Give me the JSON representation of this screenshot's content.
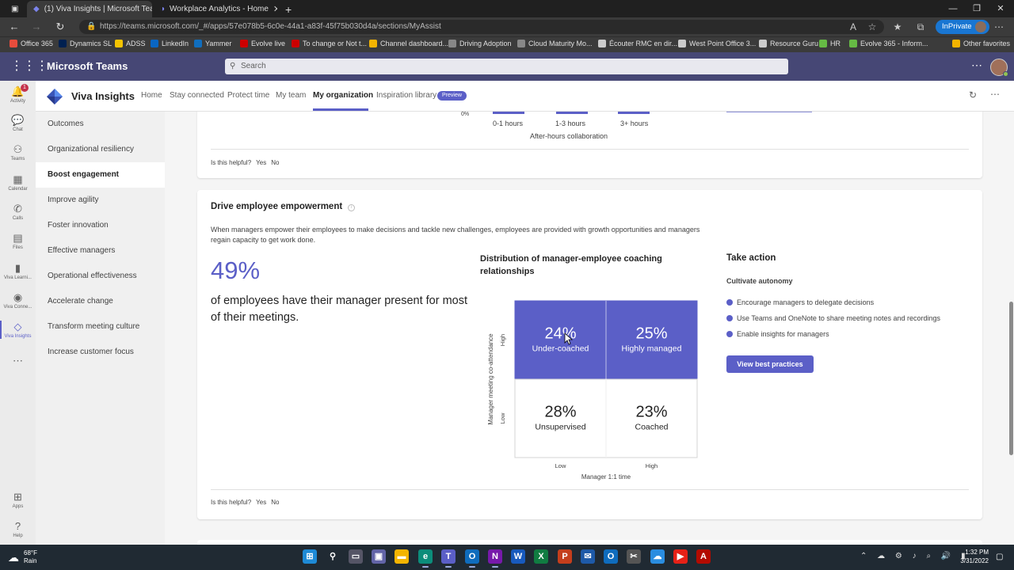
{
  "browser": {
    "tabs": [
      {
        "title": "(1) Viva Insights | Microsoft Team"
      },
      {
        "title": "Workplace Analytics - Home"
      }
    ],
    "url": "https://teams.microsoft.com/_#/apps/57e078b5-6c0e-44a1-a83f-45f75b030d4a/sections/MyAssist",
    "inprivate_label": "InPrivate",
    "favorites": [
      "Office 365",
      "Dynamics SL",
      "ADSS",
      "LinkedIn",
      "Yammer",
      "Evolve live",
      "To change or Not t...",
      "Channel dashboard...",
      "Driving Adoption",
      "Cloud Maturity Mo...",
      "Écouter RMC en dir...",
      "West Point Office 3...",
      "Resource Guru",
      "HR",
      "Evolve 365 - Inform...",
      "Other favorites"
    ]
  },
  "teams": {
    "app_name": "Microsoft Teams",
    "search_placeholder": "Search",
    "rail": [
      {
        "label": "Activity",
        "icon": "bell-icon",
        "badge": "1"
      },
      {
        "label": "Chat",
        "icon": "chat-icon"
      },
      {
        "label": "Teams",
        "icon": "teams-icon"
      },
      {
        "label": "Calendar",
        "icon": "calendar-icon"
      },
      {
        "label": "Calls",
        "icon": "phone-icon"
      },
      {
        "label": "Files",
        "icon": "file-icon"
      },
      {
        "label": "Viva Learni...",
        "icon": "viva-learning-icon"
      },
      {
        "label": "Viva Conne...",
        "icon": "viva-connections-icon"
      },
      {
        "label": "Viva Insights",
        "icon": "viva-insights-icon",
        "selected": true
      },
      {
        "label": "Apps",
        "icon": "apps-icon"
      },
      {
        "label": "Help",
        "icon": "help-icon"
      }
    ]
  },
  "app": {
    "name": "Viva Insights",
    "tabs": [
      "Home",
      "Stay connected",
      "Protect time",
      "My team",
      "My organization",
      "Inspiration library"
    ],
    "selected_tab": "My organization",
    "preview_badge": "Preview"
  },
  "sidenav": [
    "Outcomes",
    "Organizational resiliency",
    "Boost engagement",
    "Improve agility",
    "Foster innovation",
    "Effective managers",
    "Operational effectiveness",
    "Accelerate change",
    "Transform meeting culture",
    "Increase customer focus"
  ],
  "sidenav_selected": "Boost engagement",
  "card1": {
    "y_tick": "0%",
    "bars": [
      "0-1 hours",
      "1-3 hours",
      "3+ hours"
    ],
    "xlabel": "After-hours collaboration",
    "helpful": {
      "q": "Is this helpful?",
      "yes": "Yes",
      "no": "No"
    }
  },
  "card2": {
    "title": "Drive employee empowerment",
    "description": "When managers empower their employees to make decisions and tackle new challenges, employees are provided with growth opportunities and managers regain capacity to get work done.",
    "stat": "49%",
    "stat_desc": "of employees have their manager present for most of their meetings.",
    "chart_title": "Distribution of manager-employee coaching relationships",
    "take_action": {
      "title": "Take action",
      "subtitle": "Cultivate autonomy",
      "items": [
        "Encourage managers to delegate decisions",
        "Use Teams and OneNote to share meeting notes and recordings",
        "Enable insights for managers"
      ],
      "button": "View best practices"
    },
    "helpful": {
      "q": "Is this helpful?",
      "yes": "Yes",
      "no": "No"
    }
  },
  "chart_data": {
    "type": "heatmap",
    "title": "Distribution of manager-employee coaching relationships",
    "xlabel": "Manager 1:1 time",
    "ylabel": "Manager meeting co-attendance",
    "x_categories": [
      "Low",
      "High"
    ],
    "y_categories": [
      "High",
      "Low"
    ],
    "cells": [
      {
        "x": "Low",
        "y": "High",
        "value": 24,
        "label": "24%",
        "name": "Under-coached",
        "highlight": true
      },
      {
        "x": "High",
        "y": "High",
        "value": 25,
        "label": "25%",
        "name": "Highly managed",
        "highlight": true
      },
      {
        "x": "Low",
        "y": "Low",
        "value": 28,
        "label": "28%",
        "name": "Unsupervised",
        "highlight": false
      },
      {
        "x": "High",
        "y": "Low",
        "value": 23,
        "label": "23%",
        "name": "Coached",
        "highlight": false
      }
    ],
    "colors": {
      "highlight": "#5b5fc7",
      "plain": "#ffffff"
    }
  },
  "taskbar": {
    "weather_temp": "68°F",
    "weather_desc": "Rain",
    "time": "1:32 PM",
    "date": "3/31/2022"
  },
  "colors": {
    "brand": "#5b5fc7",
    "teams_header": "#464775"
  }
}
